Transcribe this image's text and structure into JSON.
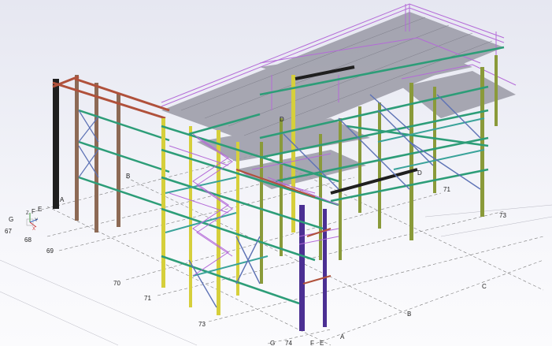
{
  "grid_labels": {
    "letters": {
      "A_left": "A",
      "B_left": "B",
      "C_right": "C",
      "B_right": "B",
      "A_right": "A",
      "E_bottom": "E",
      "F_bottom": "F",
      "G_bottom": "G",
      "D_mid": "D",
      "D_right": "D",
      "G_left": "G",
      "F_left": "F",
      "E_left": "E"
    },
    "numbers": {
      "n67": "67",
      "n68": "68",
      "n69": "69",
      "n70": "70",
      "n71": "71",
      "n73": "73",
      "n74": "74",
      "n71_right": "71",
      "n73_right": "73"
    }
  },
  "view_axes": {
    "x_label": "X",
    "y_label": "Y",
    "z_label": "Z"
  },
  "colors": {
    "green_beam": "#2d9d78",
    "teal_beam": "#3aa39a",
    "yellow_column": "#d6cf3b",
    "olive_column": "#8a9a3a",
    "red_beam": "#b0513b",
    "brown_column": "#8d6a55",
    "black_column": "#1f1f1f",
    "purple_rail": "#b46ad8",
    "blue_brace": "#5d72b5",
    "violet_column": "#4b2f93",
    "deck_grey": "#9a9aa6",
    "grid_line": "#7a7a7a"
  }
}
